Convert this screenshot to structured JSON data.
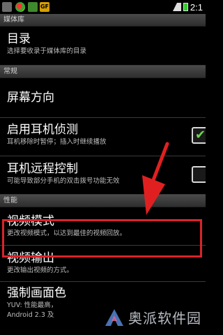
{
  "status_bar": {
    "time": "2:1",
    "icon4_label": "GF"
  },
  "categories": [
    {
      "label": "媒体库"
    },
    {
      "label": "常规"
    },
    {
      "label": "性能"
    }
  ],
  "items": {
    "directory": {
      "title": "目录",
      "summary": "选择要收录于媒体库的目录"
    },
    "orientation": {
      "title": "屏幕方向",
      "summary": ""
    },
    "headset_detect": {
      "title": "启用耳机侦测",
      "summary": "耳机移除时暂停；插入时继续播放",
      "checked": true
    },
    "headset_remote": {
      "title": "耳机远程控制",
      "summary": "可能导致部分手机的双击拨号功能无效",
      "checked": false
    },
    "video_mode": {
      "title": "视频模式",
      "summary": "更改视频模式，以达到最佳的视频回放。"
    },
    "video_output": {
      "title": "视频输出",
      "summary": "更改输出视频的方式。"
    },
    "force_frame": {
      "title": "强制画面色",
      "summary_1": "YUV: 性能最高，",
      "summary_2": "Android 2.3 及"
    }
  },
  "watermark": {
    "text": "奥派软件园"
  },
  "colors": {
    "highlight": "#d8242a",
    "arrow": "#e02020",
    "check": "#6ad84a"
  }
}
